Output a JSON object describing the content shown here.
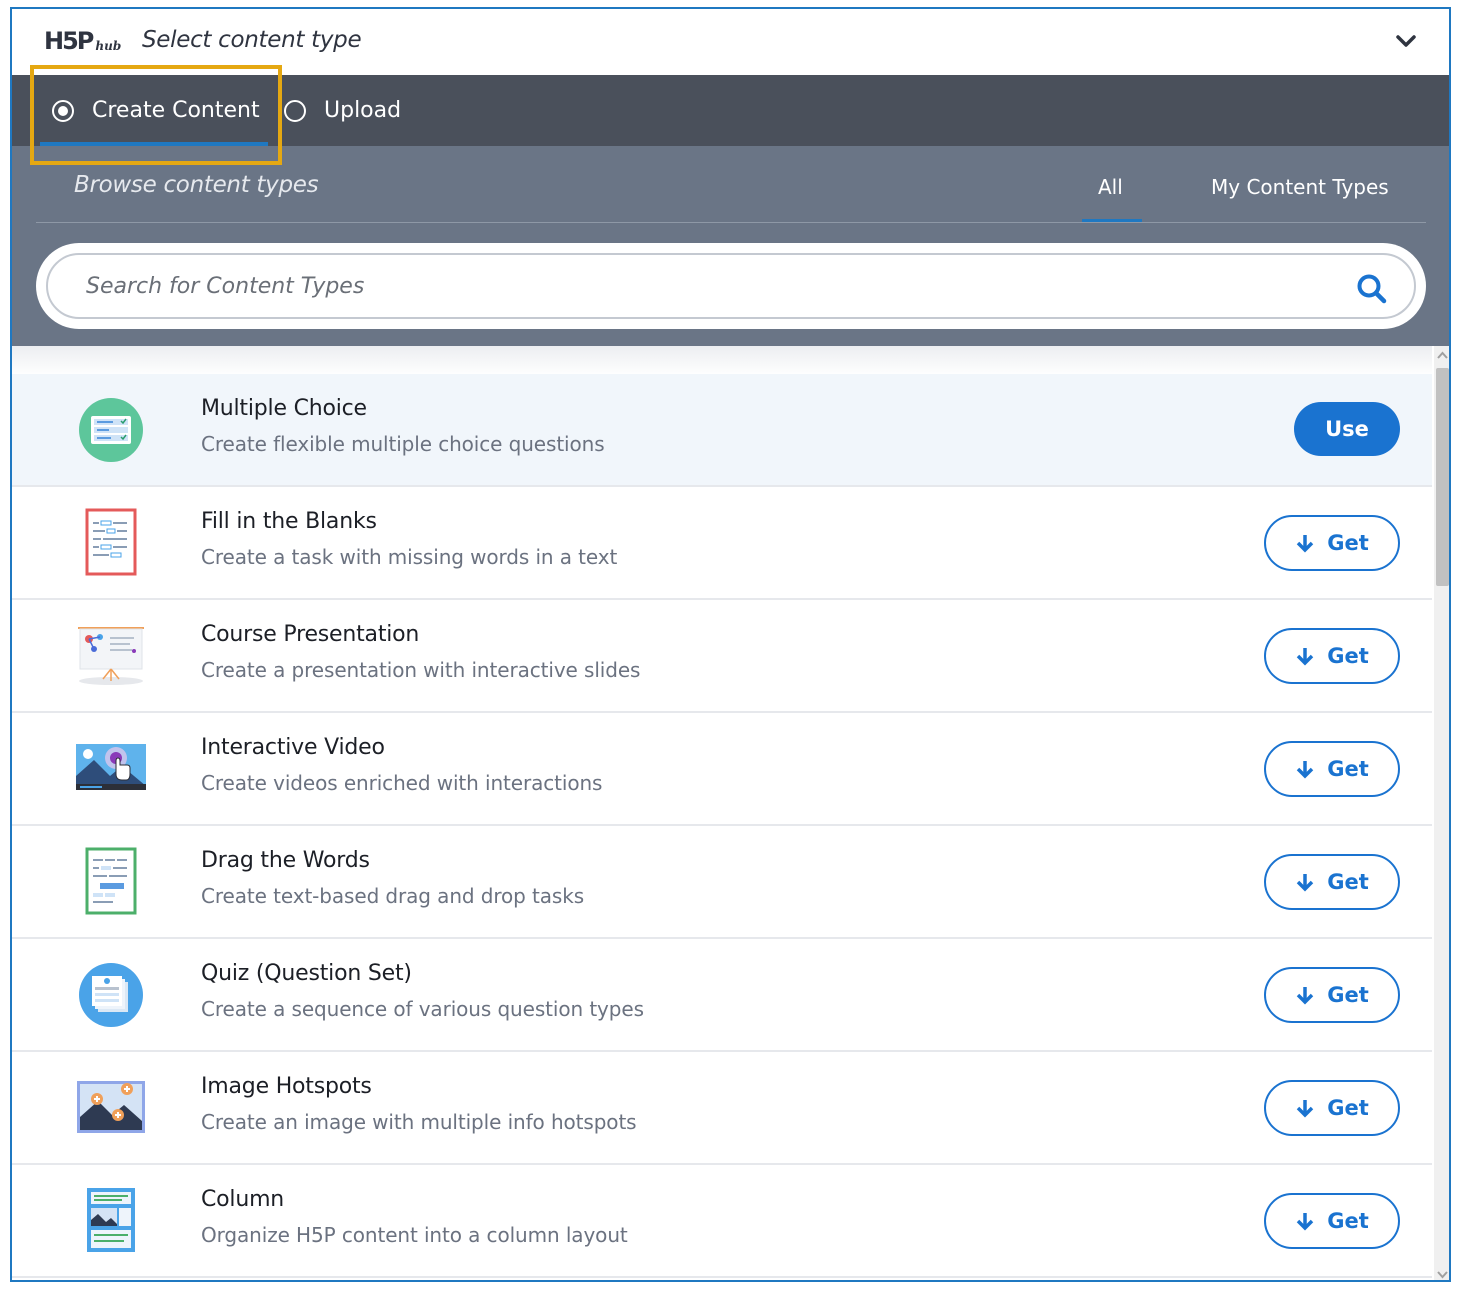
{
  "header": {
    "logo_main": "H5P",
    "logo_sub": "hub",
    "title": "Select content type"
  },
  "panel_tabs": {
    "create": "Create Content",
    "upload": "Upload"
  },
  "browse": {
    "title": "Browse content types",
    "filter_all": "All",
    "filter_mine": "My Content Types"
  },
  "search": {
    "placeholder": "Search for Content Types"
  },
  "buttons": {
    "use": "Use",
    "get": "Get"
  },
  "items": [
    {
      "title": "Multiple Choice",
      "desc": "Create flexible multiple choice questions",
      "icon": "multiple-choice-icon",
      "action": "use"
    },
    {
      "title": "Fill in the Blanks",
      "desc": "Create a task with missing words in a text",
      "icon": "fill-in-the-blanks-icon",
      "action": "get"
    },
    {
      "title": "Course Presentation",
      "desc": "Create a presentation with interactive slides",
      "icon": "course-presentation-icon",
      "action": "get"
    },
    {
      "title": "Interactive Video",
      "desc": "Create videos enriched with interactions",
      "icon": "interactive-video-icon",
      "action": "get"
    },
    {
      "title": "Drag the Words",
      "desc": "Create text-based drag and drop tasks",
      "icon": "drag-the-words-icon",
      "action": "get"
    },
    {
      "title": "Quiz (Question Set)",
      "desc": "Create a sequence of various question types",
      "icon": "quiz-icon",
      "action": "get"
    },
    {
      "title": "Image Hotspots",
      "desc": "Create an image with multiple info hotspots",
      "icon": "image-hotspots-icon",
      "action": "get"
    },
    {
      "title": "Column",
      "desc": "Organize H5P content into a column layout",
      "icon": "column-icon",
      "action": "get"
    }
  ],
  "colors": {
    "accent": "#1a73d0",
    "tab_bar": "#4a505b",
    "browse_bg": "#6a7586",
    "highlight": "#e5a812"
  }
}
